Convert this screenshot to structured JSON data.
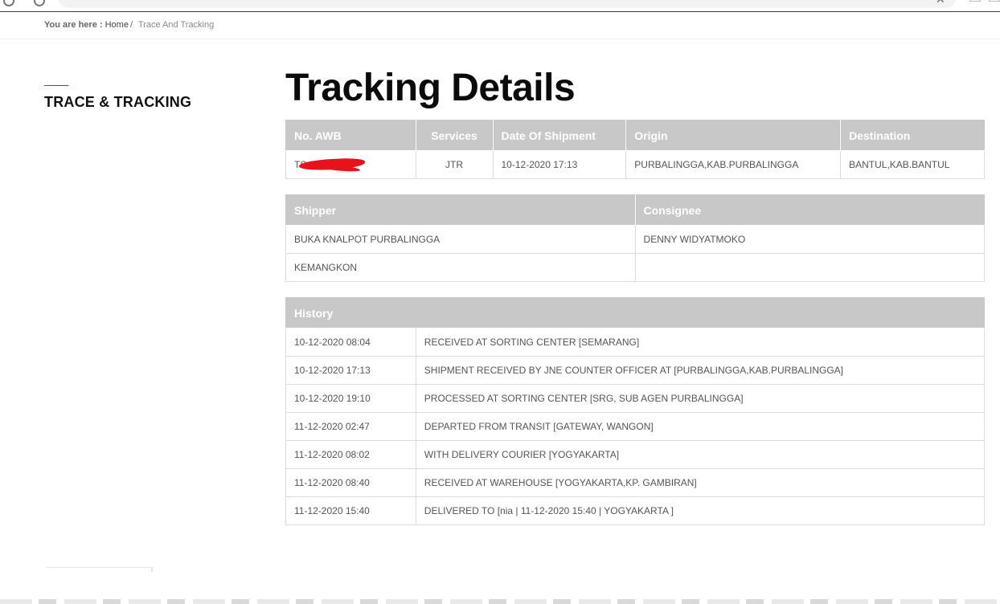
{
  "breadcrumb": {
    "prefix": "You are here :",
    "home": "Home",
    "separator": "/",
    "current": "Trace And Tracking"
  },
  "sidebar": {
    "title": "TRACE & TRACKING",
    "accent_color": "#e01b1b"
  },
  "main": {
    "title": "Tracking Details",
    "shipment": {
      "headers": [
        "No. AWB",
        "Services",
        "Date Of Shipment",
        "Origin",
        "Destination"
      ],
      "row": {
        "awb": "TS            673",
        "service": "JTR",
        "date": "10-12-2020 17:13",
        "origin": "PURBALINGGA,KAB.PURBALINGGA",
        "destination": "BANTUL,KAB.BANTUL"
      }
    },
    "parties": {
      "headers": [
        "Shipper",
        "Consignee"
      ],
      "shipper_name": "BUKA KNALPOT PURBALINGGA",
      "consignee_name": "DENNY WIDYATMOKO",
      "shipper_city": "KEMANGKON",
      "consignee_city": ""
    },
    "history": {
      "header": "History",
      "rows": [
        {
          "time": "10-12-2020 08:04",
          "status": "RECEIVED AT SORTING CENTER [SEMARANG]"
        },
        {
          "time": "10-12-2020 17:13",
          "status": "SHIPMENT RECEIVED BY JNE COUNTER OFFICER AT [PURBALINGGA,KAB.PURBALINGGA]"
        },
        {
          "time": "10-12-2020 19:10",
          "status": "PROCESSED AT SORTING CENTER [SRG, SUB AGEN PURBALINGGA]"
        },
        {
          "time": "11-12-2020 02:47",
          "status": "DEPARTED FROM TRANSIT [GATEWAY, WANGON]"
        },
        {
          "time": "11-12-2020 08:02",
          "status": "WITH DELIVERY COURIER [YOGYAKARTA]"
        },
        {
          "time": "11-12-2020 08:40",
          "status": "RECEIVED AT WAREHOUSE [YOGYAKARTA,KP. GAMBIRAN]"
        },
        {
          "time": "11-12-2020 15:40",
          "status": "DELIVERED TO [nia | 11-12-2020 15:40 | YOGYAKARTA ]"
        }
      ]
    },
    "colors": {
      "header_bg": "#c8c8c8",
      "header_text": "#ffffff",
      "border": "#dcdcdc",
      "redaction": "#e8121b"
    }
  }
}
